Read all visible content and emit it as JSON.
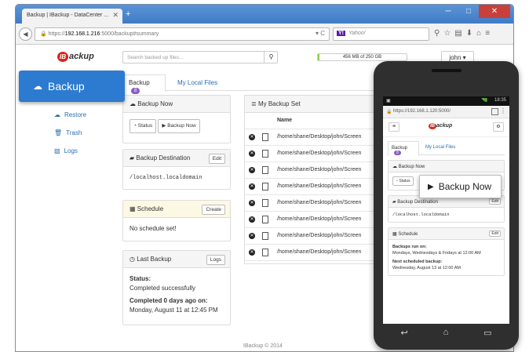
{
  "browser": {
    "tab_title": "Backup | IBackup - DataCenter ...",
    "tab_close": "✕",
    "new_tab": "+",
    "url_prefix": "https://",
    "url_host": "192.168.1.216",
    "url_rest": ":5000/backup#summary",
    "search_placeholder": "Yahoo!",
    "search_engine_badge": "Y!",
    "win_min": "─",
    "win_max": "□",
    "win_close": "✕"
  },
  "header": {
    "logo_mark": "IB",
    "logo_text": "ackup",
    "search_placeholder": "Search backed up files...",
    "storage_text": "456 MB of 250 GB",
    "storage_fraction": 0.02,
    "user_label": "john ▾"
  },
  "sidebar": {
    "active_label": "Backup",
    "items": [
      {
        "label": "Restore"
      },
      {
        "label": "Trash"
      },
      {
        "label": "Logs"
      }
    ]
  },
  "tabs": {
    "backup_label": "Backup",
    "backup_count": "8",
    "local_label": "My Local Files"
  },
  "backup_now": {
    "title": "Backup Now",
    "status_btn": "Status",
    "backup_btn": "Backup Now"
  },
  "destination": {
    "title": "Backup Destination",
    "edit_btn": "Edit",
    "value": "/localhost.localdomain"
  },
  "schedule": {
    "title": "Schedule",
    "create_btn": "Create",
    "value": "No schedule set!"
  },
  "last_backup": {
    "title": "Last Backup",
    "logs_btn": "Logs",
    "status_label": "Status:",
    "status_value": "Completed successfully",
    "completed_label": "Completed 0 days ago on:",
    "completed_value": "Monday, August 11 at 12:45 PM"
  },
  "backup_set": {
    "title": "My Backup Set",
    "column_name": "Name",
    "rows": [
      "/home/shane/Desktop/john/Screen",
      "/home/shane/Desktop/john/Screen",
      "/home/shane/Desktop/john/Screen",
      "/home/shane/Desktop/john/Screen",
      "/home/shane/Desktop/john/Screen",
      "/home/shane/Desktop/john/Screen",
      "/home/shane/Desktop/john/Screen",
      "/home/shane/Desktop/john/Screen"
    ]
  },
  "footer": "IBackup © 2014",
  "phone": {
    "time": "18:35",
    "url": "https://192.168.1.120:5000/",
    "tab_backup": "Backup",
    "tab_badge": "8",
    "tab_local": "My Local Files",
    "backup_now_title": "Backup Now",
    "status_btn": "Status",
    "backup_now_big": "Backup Now",
    "destination_title": "Backup Destination",
    "edit": "Edit",
    "destination_value": "/localhost.localdomain",
    "schedule_title": "Schedule",
    "runs_label": "Backups run on:",
    "runs_value": "Mondays, Wednesdays & Fridays at 12:00 AM",
    "next_label": "Next scheduled backup:",
    "next_value": "Wednesday, August 13 at 12:00 AM"
  }
}
